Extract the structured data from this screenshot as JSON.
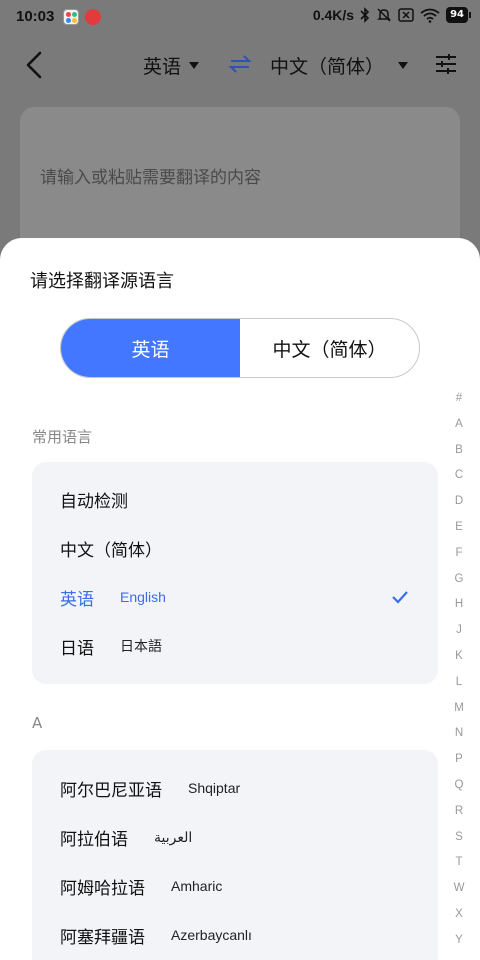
{
  "status_bar": {
    "time": "10:03",
    "net_speed": "0.4K/s",
    "battery": "94"
  },
  "top_bar": {
    "source_lang": "英语",
    "target_lang": "中文（简体）"
  },
  "input": {
    "placeholder": "请输入或粘贴需要翻译的内容"
  },
  "sheet": {
    "title": "请选择翻译源语言",
    "segment": {
      "left": "英语",
      "right": "中文（简体）"
    },
    "common_header": "常用语言",
    "common": [
      {
        "zh": "自动检测",
        "native": ""
      },
      {
        "zh": "中文（简体）",
        "native": ""
      },
      {
        "zh": "英语",
        "native": "English",
        "selected": true
      },
      {
        "zh": "日语",
        "native": "日本語"
      }
    ],
    "a_header": "A",
    "a_list": [
      {
        "zh": "阿尔巴尼亚语",
        "native": "Shqiptar"
      },
      {
        "zh": "阿拉伯语",
        "native": "العربية"
      },
      {
        "zh": "阿姆哈拉语",
        "native": "Amharic"
      },
      {
        "zh": "阿塞拜疆语",
        "native": "Azerbaycanlı"
      }
    ],
    "index": [
      "#",
      "A",
      "B",
      "C",
      "D",
      "E",
      "F",
      "G",
      "H",
      "J",
      "K",
      "L",
      "M",
      "N",
      "P",
      "Q",
      "R",
      "S",
      "T",
      "W",
      "X",
      "Y",
      "Z"
    ]
  },
  "colors": {
    "accent": "#4477ff",
    "selected_text": "#3a6ee8"
  }
}
